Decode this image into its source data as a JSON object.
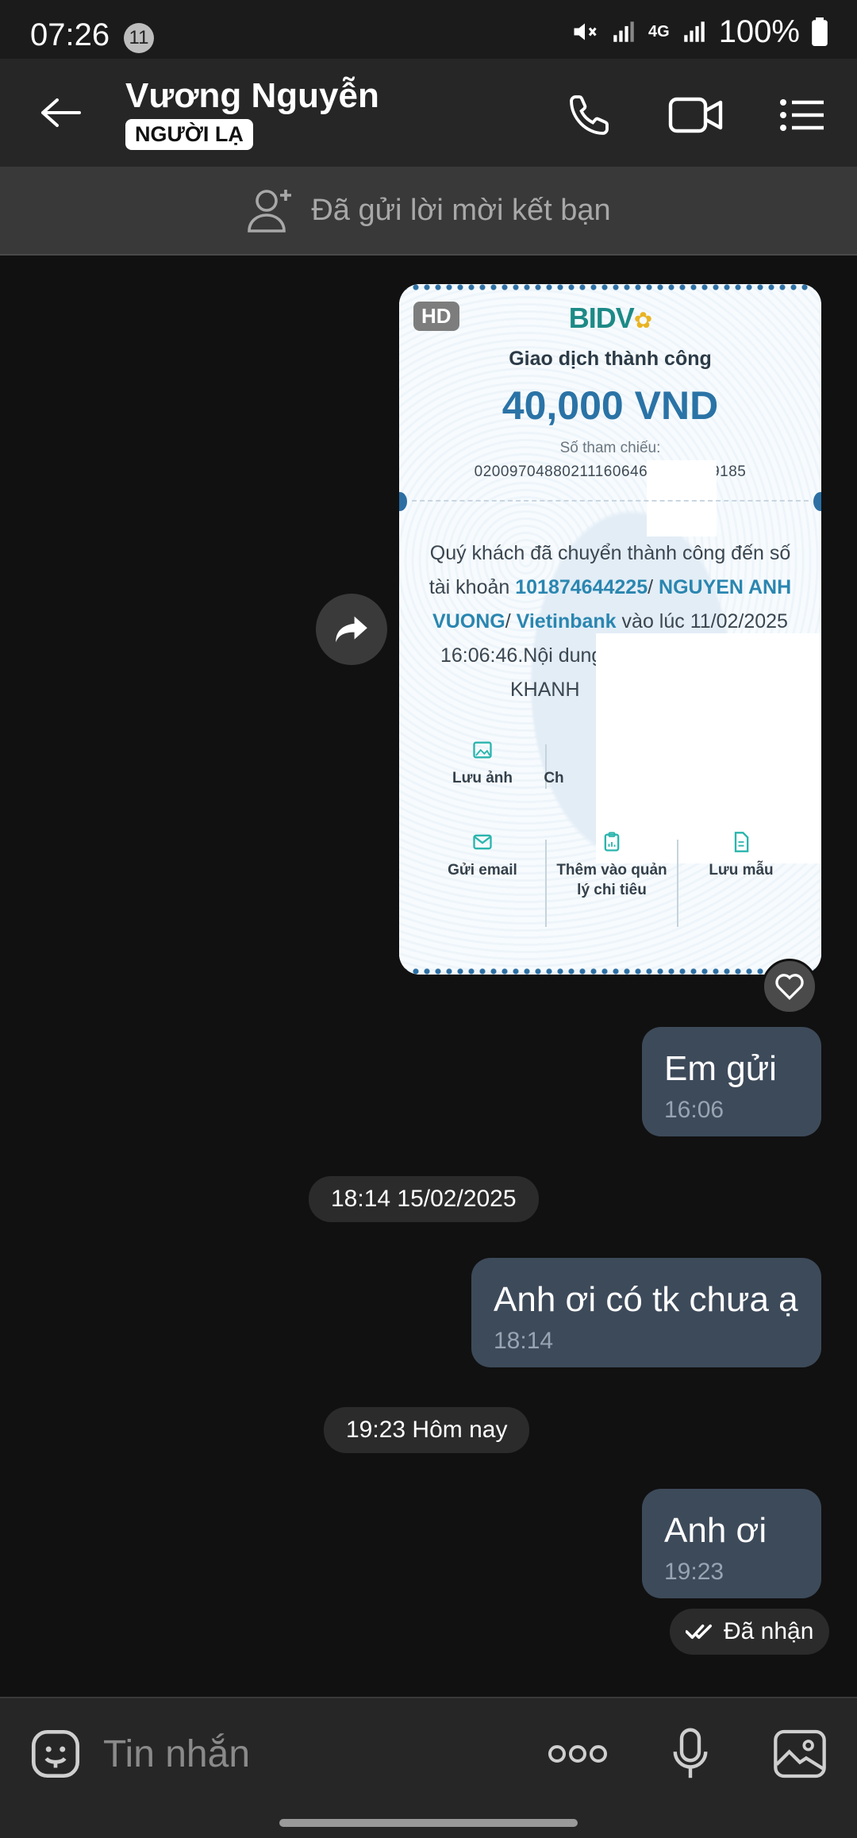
{
  "status_bar": {
    "time": "07:26",
    "notification_count": "11",
    "network": "4G",
    "battery": "100%"
  },
  "header": {
    "contact_name": "Vương Nguyễn",
    "stranger_tag": "NGƯỜI LẠ",
    "icons": [
      "back-arrow-icon",
      "phone-icon",
      "video-call-icon",
      "menu-list-icon"
    ]
  },
  "friend_request": {
    "text": "Đã gửi lời mời kết bạn",
    "icon": "add-friend-icon"
  },
  "receipt": {
    "hd_badge": "HD",
    "bank_logo": "BIDV",
    "title": "Giao dịch thành công",
    "amount": "40,000 VND",
    "ref_label": "Số tham chiếu:",
    "ref_number": "02009704880211160646",
    "ref_suffix": "349185",
    "body_line1": "Quý khách đã chuyển thành công đến số",
    "body_line2_pre": "tài khoản ",
    "account_number": "101874644225",
    "body_line2_mid": "/ ",
    "account_name": "NGUYEN ANH",
    "account_name2": "VUONG",
    "body_line3_mid": "/ ",
    "bank_name": "Vietinbank",
    "body_line3_post": " vào lúc 11/02/2025",
    "body_line4": "16:06:46.Nội dung",
    "body_line5": "KHANH",
    "actions": {
      "save_image": "Lưu ảnh",
      "share_partial": "Ch",
      "send_email": "Gửi email",
      "add_expense": "Thêm vào quản lý chi tiêu",
      "save_template": "Lưu mẫu"
    }
  },
  "messages": [
    {
      "text": "Em gửi",
      "time": "16:06"
    },
    {
      "text": "Anh ơi có tk chưa ạ",
      "time": "18:14"
    },
    {
      "text": "Anh ơi",
      "time": "19:23"
    }
  ],
  "dividers": {
    "first": "18:14 15/02/2025",
    "second": "19:23 Hôm nay"
  },
  "seen_status": "Đã nhận",
  "input": {
    "placeholder": "Tin nhắn"
  },
  "colors": {
    "background": "#111111",
    "bubble": "#3d4a5a",
    "header": "#262626",
    "receipt_amount": "#2a73a6",
    "bidv_green": "#1d8a86"
  }
}
